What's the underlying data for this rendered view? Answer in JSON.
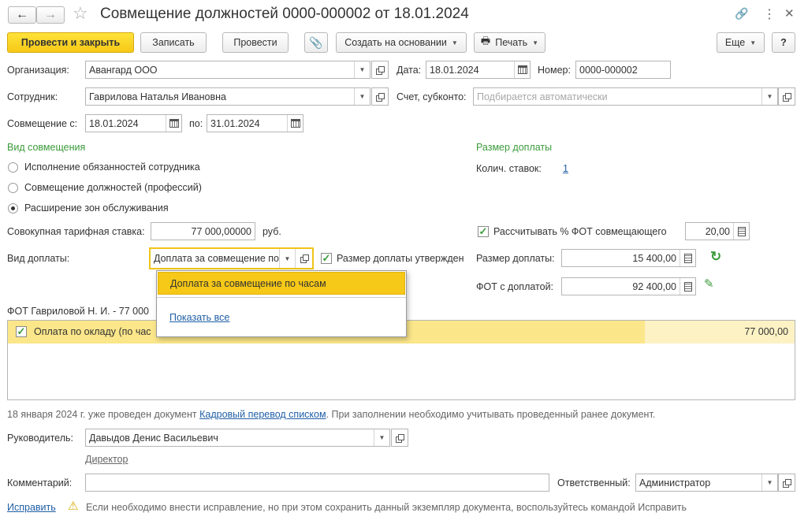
{
  "window": {
    "title": "Совмещение должностей 0000-000002 от 18.01.2024"
  },
  "toolbar": {
    "post_close": "Провести и закрыть",
    "save": "Записать",
    "post": "Провести",
    "create_based": "Создать на основании",
    "print": "Печать",
    "more": "Еще",
    "help": "?"
  },
  "header": {
    "org_label": "Организация:",
    "org_value": "Авангард ООО",
    "date_label": "Дата:",
    "date_value": "18.01.2024",
    "number_label": "Номер:",
    "number_value": "0000-000002",
    "employee_label": "Сотрудник:",
    "employee_value": "Гаврилова Наталья Ивановна",
    "account_label": "Счет, субконто:",
    "account_placeholder": "Подбирается автоматически",
    "from_label": "Совмещение с:",
    "from_value": "18.01.2024",
    "to_label": "по:",
    "to_value": "31.01.2024"
  },
  "combo_type": {
    "title": "Вид совмещения",
    "options": [
      "Исполнение обязанностей сотрудника",
      "Совмещение должностей (профессий)",
      "Расширение зон обслуживания"
    ],
    "selected_index": 2
  },
  "surcharge": {
    "title": "Размер доплаты",
    "rates_label": "Колич. ставок:",
    "rates_value": "1",
    "calc_fot_label": "Рассчитывать % ФОТ совмещающего",
    "calc_fot_checked": true,
    "calc_fot_value": "20,00",
    "amount_label": "Размер доплаты:",
    "amount_value": "15 400,00",
    "fot_with_label": "ФОТ с доплатой:",
    "fot_with_value": "92 400,00"
  },
  "tariff": {
    "label": "Совокупная тарифная ставка:",
    "value": "77 000,00000",
    "unit": "руб."
  },
  "payment_kind": {
    "label": "Вид доплаты:",
    "value": "Доплата за совмещение по часам",
    "approved_label": "Размер доплаты утвержден",
    "approved_checked": true
  },
  "dropdown": {
    "item": "Доплата за совмещение по часам",
    "show_all": "Показать все"
  },
  "fot_table": {
    "caption": "ФОТ Гавриловой Н. И. - 77 000",
    "rows": [
      {
        "name": "Оплата по окладу (по час",
        "amount": "77 000,00",
        "checked": true
      }
    ]
  },
  "notice": {
    "prefix": "18 января 2024 г. уже проведен документ",
    "link": "Кадровый перевод списком",
    "suffix": ". При заполнении необходимо учитывать проведенный ранее документ."
  },
  "footer": {
    "manager_label": "Руководитель:",
    "manager_value": "Давыдов Денис Васильевич",
    "manager_position": "Директор",
    "comment_label": "Комментарий:",
    "comment_value": "",
    "responsible_label": "Ответственный:",
    "responsible_value": "Администратор",
    "fix_link": "Исправить",
    "fix_text": "Если необходимо внести исправление, но при этом сохранить данный экземпляр документа, воспользуйтесь командой Исправить"
  },
  "colors": {
    "primary_button": "#f6c817",
    "selected_row": "#fbe68a",
    "accent_green": "#3b9b3b",
    "link": "#1f5fa6"
  }
}
